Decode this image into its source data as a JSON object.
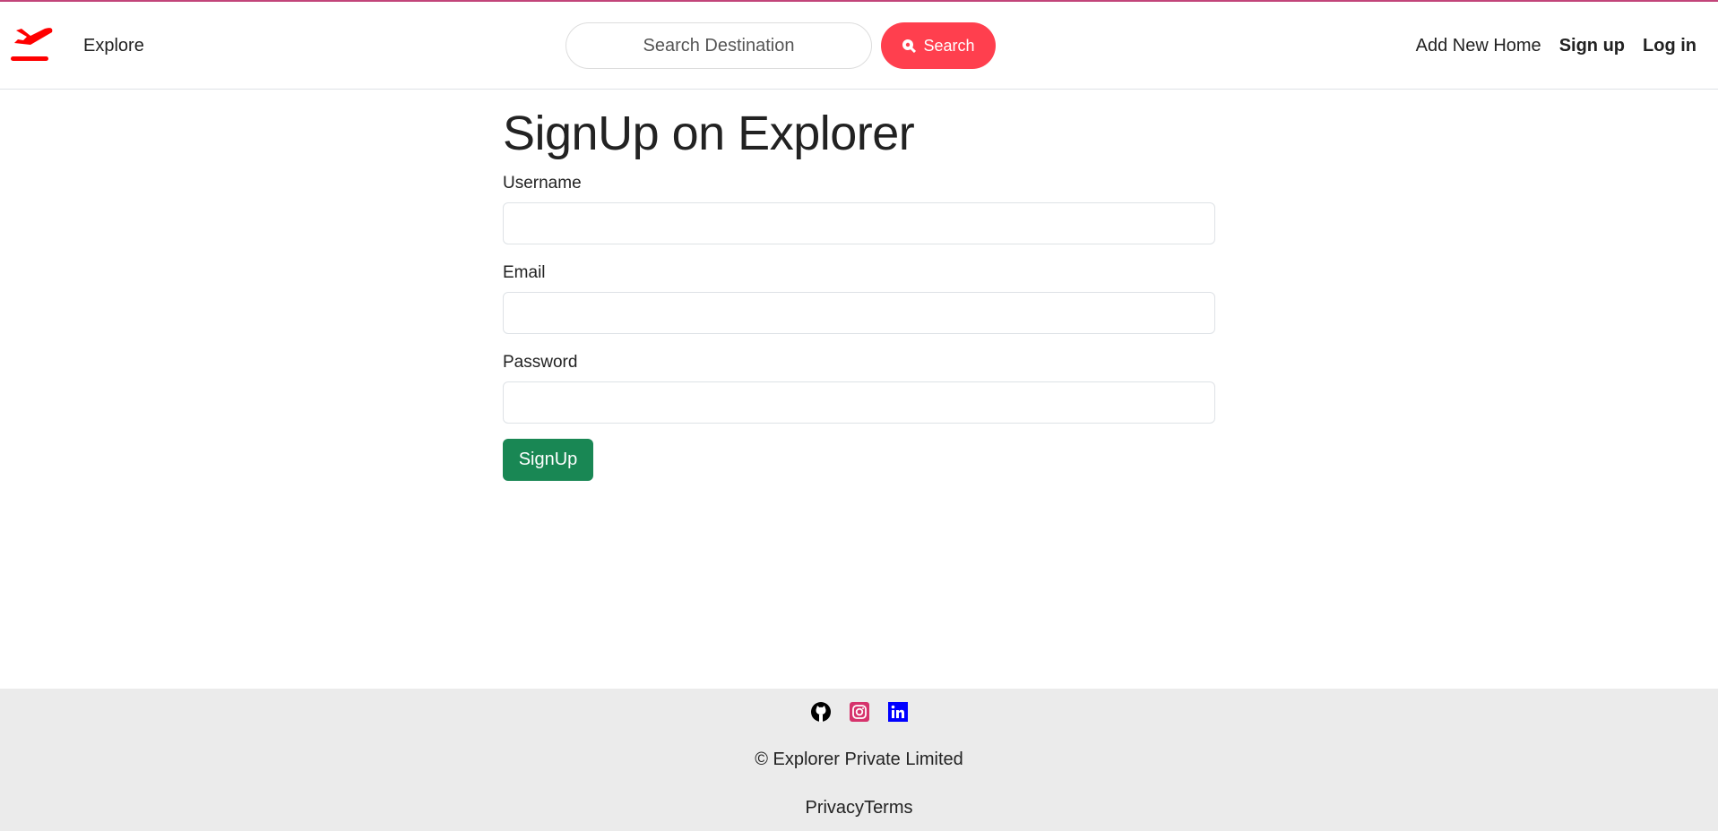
{
  "navbar": {
    "brand": "Explore",
    "search_placeholder": "Search Destination",
    "search_button": "Search",
    "links": [
      "Add New Home",
      "Sign up",
      "Log in"
    ],
    "accent": "#ff3f4e"
  },
  "form": {
    "title": "SignUp on Explorer",
    "fields": [
      {
        "label": "Username",
        "value": ""
      },
      {
        "label": "Email",
        "value": ""
      },
      {
        "label": "Password",
        "value": ""
      }
    ],
    "submit": "SignUp",
    "submit_color": "#198754"
  },
  "footer": {
    "icons": [
      "github-icon",
      "instagram-icon",
      "linkedin-icon"
    ],
    "copyright": "© Explorer Private Limited",
    "links": [
      "Privacy",
      "Terms"
    ]
  }
}
